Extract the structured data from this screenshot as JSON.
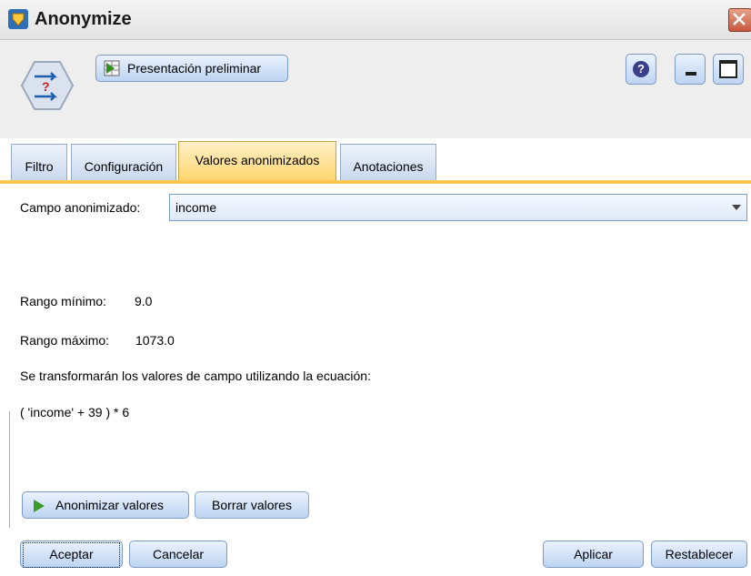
{
  "window": {
    "title": "Anonymize"
  },
  "toolbar": {
    "preview_label": "Presentación preliminar",
    "help_label": "?"
  },
  "tabs": [
    {
      "label": "Filtro"
    },
    {
      "label": "Configuración"
    },
    {
      "label": "Valores anonimizados",
      "active": true
    },
    {
      "label": "Anotaciones"
    }
  ],
  "panel": {
    "field_label": "Campo anonimizado:",
    "field_value": "income",
    "min_label": "Rango mínimo:",
    "min_value": "9.0",
    "max_label": "Rango máximo:",
    "max_value": "1073.0",
    "transform_text": "Se transformarán los valores de campo utilizando la ecuación:",
    "equation": "( 'income' + 39 ) * 6",
    "anonymize_button": "Anonimizar valores",
    "clear_button": "Borrar valores"
  },
  "footer": {
    "ok": "Aceptar",
    "cancel": "Cancelar",
    "apply": "Aplicar",
    "reset": "Restablecer"
  },
  "colors": {
    "active_tab": "#ffd46a",
    "button": "#bdd4f2",
    "run_green": "#3a9a2a"
  }
}
